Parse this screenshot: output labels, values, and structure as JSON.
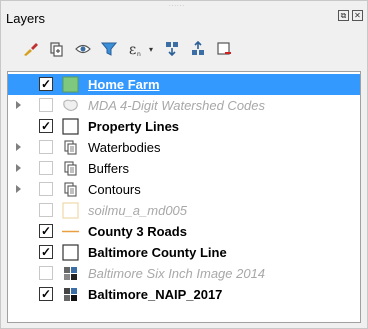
{
  "panel": {
    "title": "Layers",
    "grip": "......",
    "float_button": "⧉",
    "close_button": "✕"
  },
  "toolbar": {
    "tools": [
      {
        "name": "style-manager-icon"
      },
      {
        "name": "add-group-icon"
      },
      {
        "name": "visibility-eye-icon"
      },
      {
        "name": "filter-icon"
      },
      {
        "name": "filter-expression-icon"
      },
      {
        "name": "expand-all-icon"
      },
      {
        "name": "collapse-all-icon"
      },
      {
        "name": "remove-layer-icon"
      }
    ],
    "filter_expression_label": "ε",
    "dropdown_caret": "▾"
  },
  "layers": [
    {
      "label": "Home Farm",
      "checked": true,
      "selected": true,
      "style": "link",
      "symbol": "green-fill",
      "expandable": false
    },
    {
      "label": "MDA 4-Digit Watershed Codes",
      "checked": false,
      "selected": false,
      "style": "italic-gray",
      "symbol": "polygon-outline-gray",
      "expandable": true
    },
    {
      "label": "Property Lines",
      "checked": true,
      "selected": false,
      "style": "bold",
      "symbol": "white-box",
      "expandable": false
    },
    {
      "label": "Waterbodies",
      "checked": false,
      "selected": false,
      "style": "normal",
      "symbol": "group-folder",
      "expandable": true
    },
    {
      "label": "Buffers",
      "checked": false,
      "selected": false,
      "style": "normal",
      "symbol": "group-folder",
      "expandable": true
    },
    {
      "label": "Contours",
      "checked": false,
      "selected": false,
      "style": "normal",
      "symbol": "group-folder",
      "expandable": true
    },
    {
      "label": "soilmu_a_md005",
      "checked": false,
      "selected": false,
      "style": "italic-gray",
      "symbol": "tan-box",
      "expandable": false
    },
    {
      "label": "County 3 Roads",
      "checked": true,
      "selected": false,
      "style": "bold",
      "symbol": "orange-line",
      "expandable": false
    },
    {
      "label": "Baltimore County Line",
      "checked": true,
      "selected": false,
      "style": "bold",
      "symbol": "white-box",
      "expandable": false
    },
    {
      "label": "Baltimore Six Inch Image 2014",
      "checked": false,
      "selected": false,
      "style": "italic-gray",
      "symbol": "raster",
      "expandable": false
    },
    {
      "label": "Baltimore_NAIP_2017",
      "checked": true,
      "selected": false,
      "style": "bold",
      "symbol": "raster",
      "expandable": false
    }
  ],
  "checkmark": "✓",
  "colors": {
    "selection": "#3399ff",
    "home_farm_fill": "#7fc97f",
    "road_line": "#e8a040",
    "soil_box": "#f5e0b0"
  }
}
